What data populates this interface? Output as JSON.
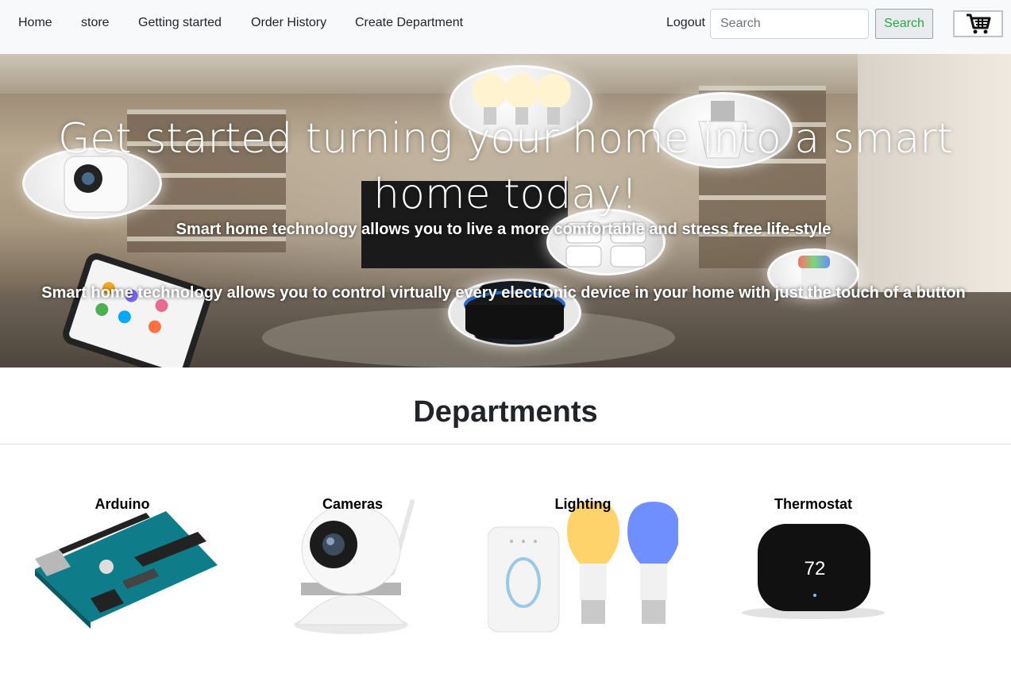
{
  "navbar": {
    "links": [
      "Home",
      "store",
      "Getting started",
      "Order History",
      "Create Department"
    ],
    "logout": "Logout",
    "search_placeholder": "Search",
    "search_button": "Search",
    "cart_icon": "shopping-cart-icon"
  },
  "hero": {
    "title": "Get started turning your home into a smart home today!",
    "subtitle_1": "Smart home technology allows you to live a more comfortable and stress free life-style",
    "subtitle_2": "Smart home technology allows you to control virtually every electronic device in your home with just the touch of a button"
  },
  "departments": {
    "heading": "Departments",
    "items": [
      {
        "label": "Arduino",
        "icon": "arduino-board-image"
      },
      {
        "label": "Cameras",
        "icon": "security-camera-image"
      },
      {
        "label": "Lighting",
        "icon": "smart-bulbs-image"
      },
      {
        "label": "Thermostat",
        "icon": "thermostat-image"
      }
    ],
    "thermostat_reading": "72"
  },
  "colors": {
    "navbar_bg": "#f8f9fa",
    "search_button_text": "#28a745",
    "arduino_board": "#0f7c8a",
    "lighting_warm": "#ffd36b",
    "lighting_cool": "#6f8fff"
  }
}
